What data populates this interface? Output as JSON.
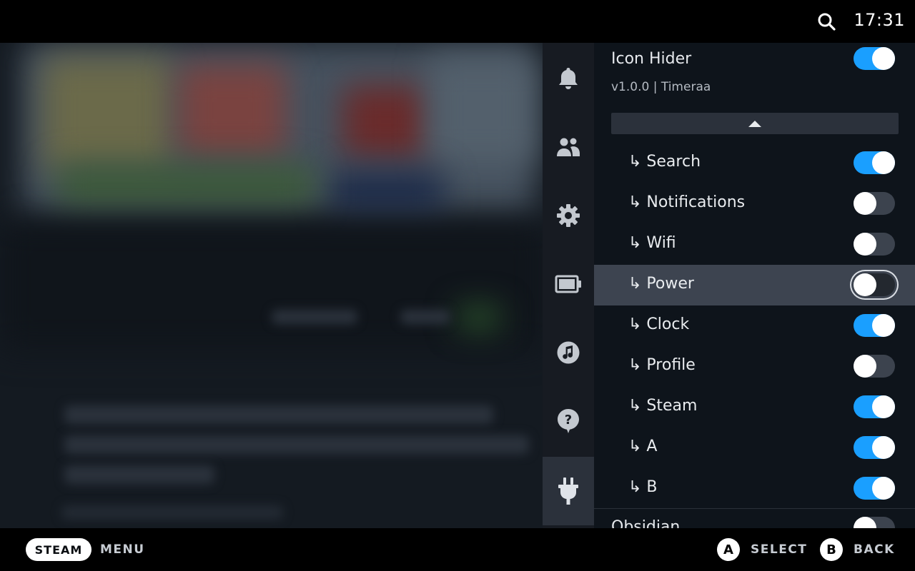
{
  "status_bar": {
    "time": "17:31",
    "search_icon": "search-icon"
  },
  "nav": {
    "items": [
      {
        "icon": "bell-icon",
        "label": "Notifications"
      },
      {
        "icon": "friends-icon",
        "label": "Friends"
      },
      {
        "icon": "gear-icon",
        "label": "Settings"
      },
      {
        "icon": "battery-icon",
        "label": "Performance"
      },
      {
        "icon": "music-icon",
        "label": "Music"
      },
      {
        "icon": "help-icon",
        "label": "Help"
      },
      {
        "icon": "plug-icon",
        "label": "Plugins",
        "active": true
      }
    ]
  },
  "plugin": {
    "title": "Icon Hider",
    "version": "v1.0.0 | Timeraa",
    "enabled": true
  },
  "options": [
    {
      "label": "↳ Search",
      "enabled": true
    },
    {
      "label": "↳ Notifications",
      "enabled": false
    },
    {
      "label": "↳ Wifi",
      "enabled": false
    },
    {
      "label": "↳ Power",
      "enabled": false,
      "focused": true
    },
    {
      "label": "↳ Clock",
      "enabled": true
    },
    {
      "label": "↳ Profile",
      "enabled": false
    },
    {
      "label": "↳ Steam",
      "enabled": true
    },
    {
      "label": "↳ A",
      "enabled": true
    },
    {
      "label": "↳ B",
      "enabled": true
    }
  ],
  "next_plugin": {
    "title": "Obsidian",
    "enabled": false
  },
  "bottom_bar": {
    "steam_label": "STEAM",
    "menu_label": "MENU",
    "a_button": "A",
    "select_label": "SELECT",
    "b_button": "B",
    "back_label": "BACK"
  },
  "colors": {
    "accent": "#1a9fff",
    "panel": "#0e141b",
    "focus_row": "#3d4450"
  }
}
